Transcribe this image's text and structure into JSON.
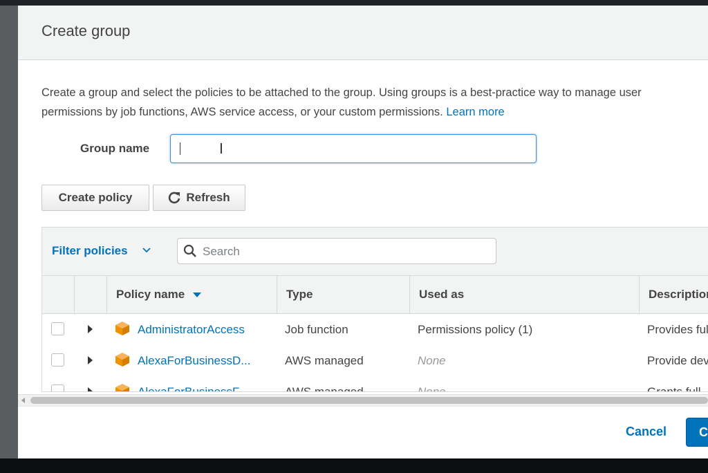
{
  "modal": {
    "title": "Create group",
    "description_text": "Create a group and select the policies to be attached to the group. Using groups is a best-practice way to manage user",
    "description_text2": "permissions by job functions, AWS service access, or your custom permissions.",
    "learn_more": "Learn more"
  },
  "group_name": {
    "label": "Group name",
    "value": ""
  },
  "toolbar": {
    "create_policy": "Create policy",
    "refresh": "Refresh"
  },
  "filter": {
    "label": "Filter policies",
    "search_placeholder": "Search"
  },
  "table": {
    "columns": [
      "Policy name",
      "Type",
      "Used as",
      "Description"
    ],
    "rows": [
      {
        "name": "AdministratorAccess",
        "type": "Job function",
        "used_as": "Permissions policy (1)",
        "description": "Provides full"
      },
      {
        "name": "AlexaForBusinessD...",
        "type": "AWS managed",
        "used_as": "None",
        "description": "Provide dev"
      },
      {
        "name": "AlexaForBusinessF...",
        "type": "AWS managed",
        "used_as": "None",
        "description": "Grants full"
      }
    ]
  },
  "footer": {
    "cancel": "Cancel",
    "create": "Create group"
  },
  "colors": {
    "accent": "#0073bb",
    "policy_icon": "#f29100"
  }
}
